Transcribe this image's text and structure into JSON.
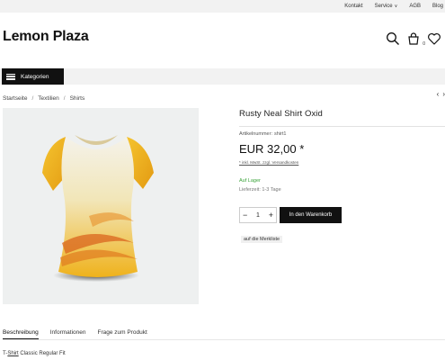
{
  "topbar": {
    "links": [
      "Kontakt",
      "Service",
      "AGB",
      "Blog"
    ]
  },
  "header": {
    "logo": "Lemon Plaza",
    "cart_count": "0",
    "icons": [
      "search-icon",
      "cart-icon",
      "heart-icon"
    ]
  },
  "nav": {
    "category_button": "Kategorien"
  },
  "breadcrumb": [
    "Startseite",
    "Textilien",
    "Shirts"
  ],
  "pager": {
    "prev": "‹",
    "next": "›"
  },
  "product": {
    "title": "Rusty Neal Shirt Oxid",
    "sku_label": "Artikelnummer:",
    "sku": "shirt1",
    "price": "EUR 32,00 *",
    "vat_note": "* inkl. MwSt. zzgl. Versandkosten",
    "stock": "Auf Lager",
    "delivery": "Lieferzeit: 1-3 Tage",
    "quantity": "1",
    "minus": "−",
    "plus": "+",
    "add_to_cart": "In den Warenkorb",
    "wishlist": "auf die Merkliste"
  },
  "tabs": {
    "items": [
      "Beschreibung",
      "Informationen",
      "Frage zum Produkt"
    ],
    "active": "Beschreibung"
  },
  "description": {
    "prefix": "T-",
    "link": "Shirt",
    "rest": " Classic Regular Fit"
  },
  "colors": {
    "accent": "#111111",
    "stock_green": "#3aa33a",
    "bar_gray": "#f2f2f2"
  }
}
